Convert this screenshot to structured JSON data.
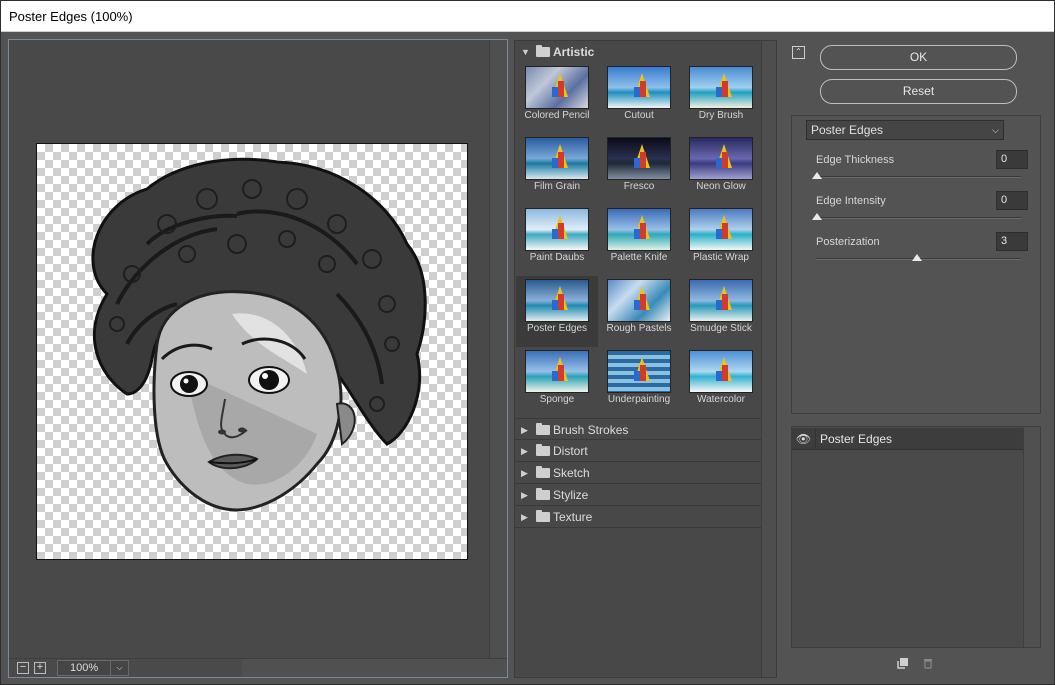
{
  "window": {
    "title": "Poster Edges (100%)"
  },
  "preview": {
    "zoom": "100%",
    "zoom_out": "−",
    "zoom_in": "+"
  },
  "filters": {
    "open_category": "Artistic",
    "thumbnails": [
      "Colored Pencil",
      "Cutout",
      "Dry Brush",
      "Film Grain",
      "Fresco",
      "Neon Glow",
      "Paint Daubs",
      "Palette Knife",
      "Plastic Wrap",
      "Poster Edges",
      "Rough Pastels",
      "Smudge Stick",
      "Sponge",
      "Underpainting",
      "Watercolor"
    ],
    "selected": "Poster Edges",
    "categories": [
      "Brush Strokes",
      "Distort",
      "Sketch",
      "Stylize",
      "Texture"
    ]
  },
  "buttons": {
    "ok": "OK",
    "reset": "Reset"
  },
  "settings": {
    "filter_select": "Poster Edges",
    "params": [
      {
        "label": "Edge Thickness",
        "value": "0",
        "level": 0.0
      },
      {
        "label": "Edge Intensity",
        "value": "0",
        "level": 0.0
      },
      {
        "label": "Posterization",
        "value": "3",
        "level": 0.5
      }
    ]
  },
  "layers": {
    "items": [
      {
        "name": "Poster Edges"
      }
    ]
  }
}
